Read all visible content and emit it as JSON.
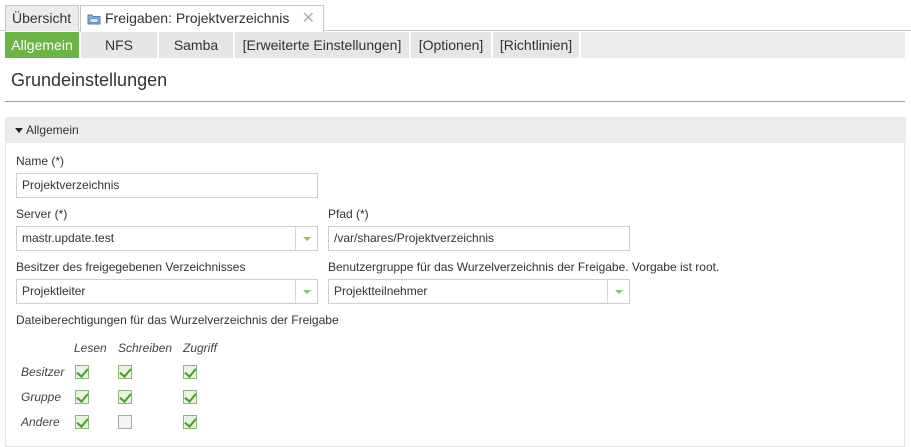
{
  "tabs": {
    "overview": "Übersicht",
    "share": "Freigaben: Projektverzeichnis",
    "close": "✕"
  },
  "subtabs": [
    "Allgemein",
    "NFS",
    "Samba",
    "[Erweiterte Einstellungen]",
    "[Optionen]",
    "[Richtlinien]"
  ],
  "page_title": "Grundeinstellungen",
  "section": {
    "title": "Allgemein"
  },
  "form": {
    "name_label": "Name (*)",
    "name_value": "Projektverzeichnis",
    "server_label": "Server (*)",
    "server_value": "mastr.update.test",
    "path_label": "Pfad (*)",
    "path_value": "/var/shares/Projektverzeichnis",
    "owner_label": "Besitzer des freigegebenen Verzeichnisses",
    "owner_value": "Projektleiter",
    "group_label": "Benutzergruppe für das Wurzelverzeichnis der Freigabe. Vorgabe ist root.",
    "group_value": "Projektteilnehmer",
    "perm_label": "Dateiberechtigungen für das Wurzelverzeichnis der Freigabe"
  },
  "permissions": {
    "columns": [
      "Lesen",
      "Schreiben",
      "Zugriff"
    ],
    "rows": [
      {
        "label": "Besitzer",
        "values": [
          true,
          true,
          true
        ]
      },
      {
        "label": "Gruppe",
        "values": [
          true,
          true,
          true
        ]
      },
      {
        "label": "Andere",
        "values": [
          true,
          false,
          true
        ]
      }
    ]
  },
  "colors": {
    "accent": "#6bb445",
    "check": "#4d9a2f"
  }
}
